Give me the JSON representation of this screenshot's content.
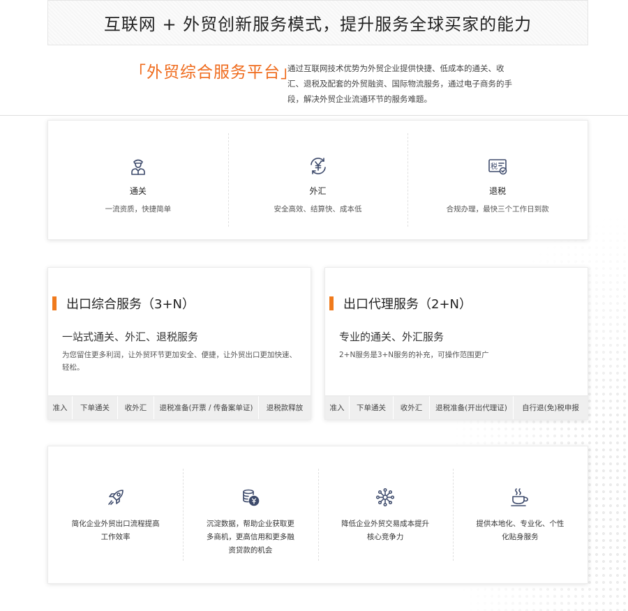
{
  "banner": {
    "title": "互联网 + 外贸创新服务模式，提升服务全球买家的能力"
  },
  "intro": {
    "title": "「外贸综合服务平台」",
    "description": "通过互联网技术优势为外贸企业提供快捷、低成本的通关、收汇、退税及配套的外贸融资、国际物流服务，通过电子商务的手段，解决外贸企业流通环节的服务难题。"
  },
  "features": [
    {
      "icon": "customs-officer-icon",
      "title": "通关",
      "desc": "一流资质，快捷简单"
    },
    {
      "icon": "yuan-exchange-icon",
      "title": "外汇",
      "desc": "安全高效、结算快、成本低"
    },
    {
      "icon": "tax-refund-icon",
      "title": "退税",
      "desc": "合规办理，最快三个工作日到款",
      "icon_text": "税"
    }
  ],
  "services": [
    {
      "title": "出口综合服务（3+N）",
      "subtitle": "一站式通关、外汇、退税服务",
      "desc": "为您留住更多利润，让外贸环节更加安全、便捷，让外贸出口更加快速、轻松。",
      "steps": [
        "准入",
        "下单通关",
        "收外汇",
        "退税准备(开票 / 传备案单证)",
        "退税款释放"
      ]
    },
    {
      "title": "出口代理服务（2+N）",
      "subtitle": "专业的通关、外汇服务",
      "desc": "2+N服务是3+N服务的补充，可操作范围更广",
      "steps": [
        "准入",
        "下单通关",
        "收外汇",
        "退税准备(开出代理证)",
        "自行退(免)税申报"
      ]
    }
  ],
  "benefits": [
    {
      "icon": "rocket-icon",
      "text": "简化企业外贸出口流程提高工作效率"
    },
    {
      "icon": "coins-icon",
      "text": "沉淀数据，帮助企业获取更多商机，更高信用和更多融资贷款的机会"
    },
    {
      "icon": "network-icon",
      "text": "降低企业外贸交易成本提升核心竞争力"
    },
    {
      "icon": "coffee-cup-icon",
      "text": "提供本地化、专业化、个性化贴身服务"
    }
  ],
  "colors": {
    "accent": "#ef6a1b",
    "icon": "#3d4a6b"
  }
}
